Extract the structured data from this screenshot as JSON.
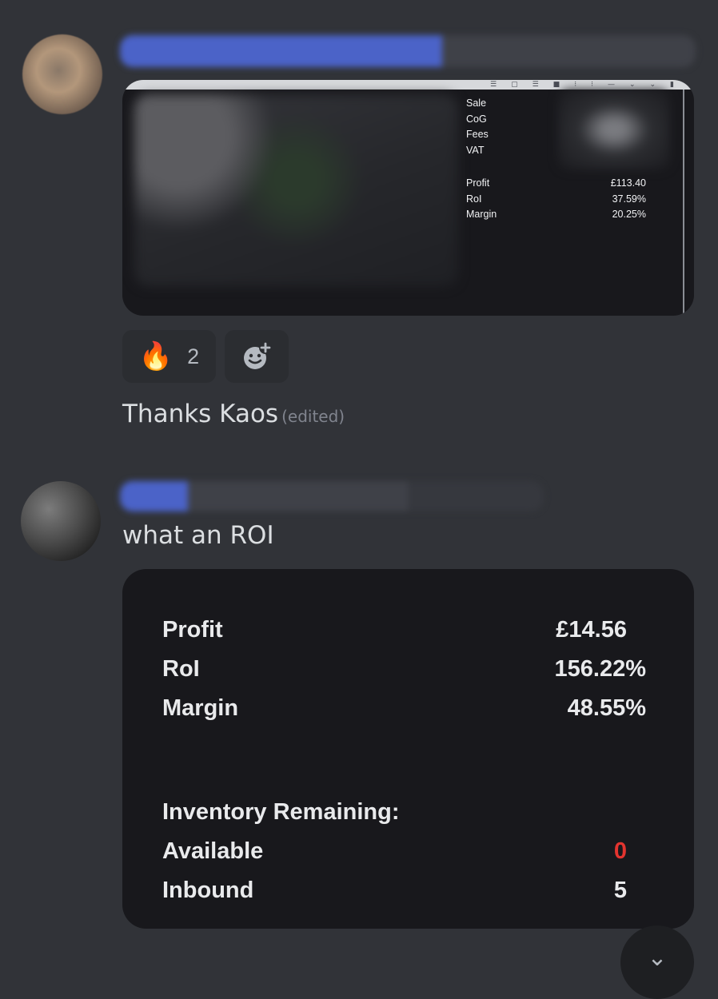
{
  "messages": [
    {
      "embed": {
        "stats": [
          {
            "label": "Sale",
            "value": ""
          },
          {
            "label": "CoG",
            "value": ""
          },
          {
            "label": "Fees",
            "value": ""
          },
          {
            "label": "VAT",
            "value": ""
          }
        ],
        "summary": [
          {
            "label": "Profit",
            "value": "£113.40"
          },
          {
            "label": "RoI",
            "value": "37.59%"
          },
          {
            "label": "Margin",
            "value": "20.25%"
          }
        ]
      },
      "reactions": [
        {
          "emoji": "🔥",
          "count": "2"
        }
      ],
      "add_reaction_icon": "add-reaction-icon",
      "text": "Thanks Kaos",
      "edited_label": "(edited)"
    },
    {
      "text": "what an ROI",
      "embed": {
        "summary": [
          {
            "label": "Profit",
            "value": "£14.56"
          },
          {
            "label": "RoI",
            "value": "156.22%"
          },
          {
            "label": "Margin",
            "value": "48.55%"
          }
        ],
        "inventory_heading": "Inventory Remaining:",
        "inventory": [
          {
            "label": "Available",
            "value": "0",
            "color": "#e3342f"
          },
          {
            "label": "Inbound",
            "value": "5"
          }
        ]
      }
    }
  ],
  "jump_button_icon": "chevron-down-icon"
}
